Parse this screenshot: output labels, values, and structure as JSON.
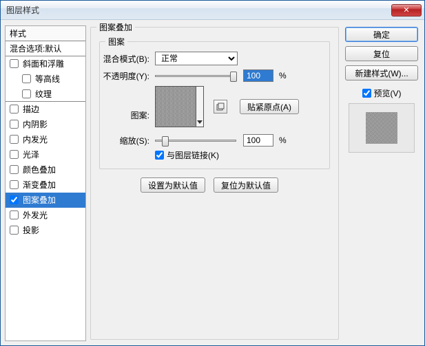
{
  "window": {
    "title": "图层样式"
  },
  "sidebar": {
    "header": "样式",
    "blend_defaults": "混合选项:默认",
    "items": [
      {
        "label": "斜面和浮雕",
        "checked": false
      },
      {
        "label": "等高线",
        "checked": false
      },
      {
        "label": "纹理",
        "checked": false
      },
      {
        "label": "描边",
        "checked": false
      },
      {
        "label": "内阴影",
        "checked": false
      },
      {
        "label": "内发光",
        "checked": false
      },
      {
        "label": "光泽",
        "checked": false
      },
      {
        "label": "颜色叠加",
        "checked": false
      },
      {
        "label": "渐变叠加",
        "checked": false
      },
      {
        "label": "图案叠加",
        "checked": true
      },
      {
        "label": "外发光",
        "checked": false
      },
      {
        "label": "投影",
        "checked": false
      }
    ]
  },
  "panel": {
    "outer_title": "图案叠加",
    "inner_title": "图案",
    "blend_mode_label": "混合模式(B):",
    "blend_mode_value": "正常",
    "opacity_label": "不透明度(Y):",
    "opacity_value": "100",
    "pct": "%",
    "pattern_label": "图案:",
    "snap_origin": "贴紧原点(A)",
    "scale_label": "缩放(S):",
    "scale_value": "100",
    "link_label": "与图层链接(K)",
    "set_default": "设置为默认值",
    "reset_default": "复位为默认值"
  },
  "right": {
    "ok": "确定",
    "cancel": "复位",
    "new_style": "新建样式(W)...",
    "preview_label": "预览(V)"
  }
}
